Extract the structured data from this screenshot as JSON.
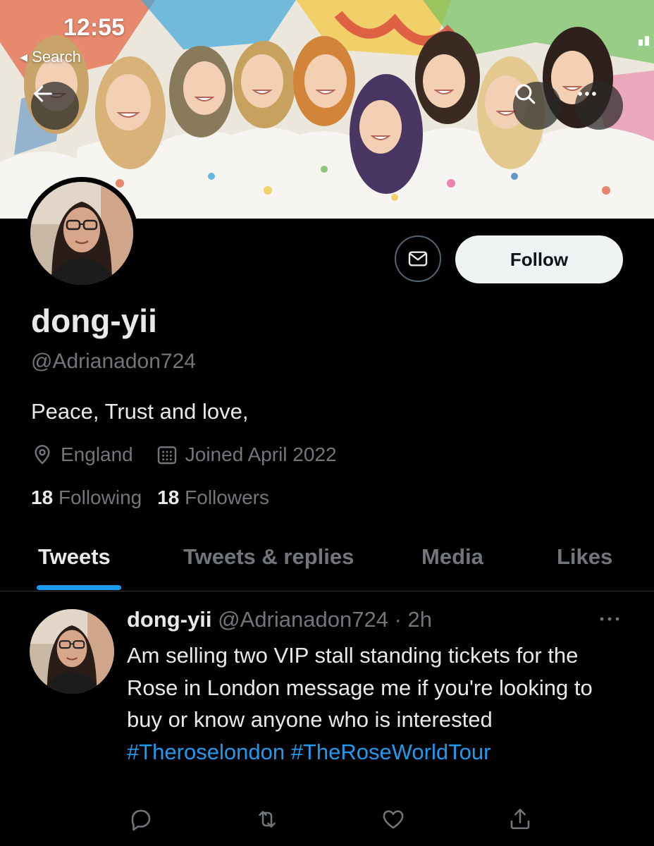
{
  "status_bar": {
    "time": "12:55",
    "back_label": "◂ Search"
  },
  "profile": {
    "display_name": "dong-yii",
    "handle": "@Adrianadon724",
    "bio": "Peace, Trust and love,",
    "location": "England",
    "joined": "Joined April 2022",
    "following_count": "18",
    "following_label": "Following",
    "followers_count": "18",
    "followers_label": "Followers"
  },
  "actions": {
    "follow_label": "Follow"
  },
  "tabs": [
    {
      "label": "Tweets",
      "active": true
    },
    {
      "label": "Tweets & replies",
      "active": false
    },
    {
      "label": "Media",
      "active": false
    },
    {
      "label": "Likes",
      "active": false
    }
  ],
  "tweet": {
    "name": "dong-yii",
    "handle": "@Adrianadon724",
    "separator": " · ",
    "time": "2h",
    "text": "Am selling two VIP stall standing tickets for the Rose in London message me if you're looking to buy or know anyone who is interested",
    "hashtags": [
      "#Theroselondon",
      "#TheRoseWorldTour"
    ]
  },
  "icons": {
    "back": "arrow-left-icon",
    "search": "search-icon",
    "more": "more-horizontal-icon",
    "message": "envelope-icon",
    "location": "location-pin-icon",
    "calendar": "calendar-icon",
    "reply": "reply-icon",
    "retweet": "retweet-icon",
    "like": "heart-icon",
    "share": "share-icon"
  },
  "colors": {
    "background": "#000000",
    "accent": "#1d9bf0",
    "muted": "#71767b",
    "text": "#e7e9ea"
  }
}
